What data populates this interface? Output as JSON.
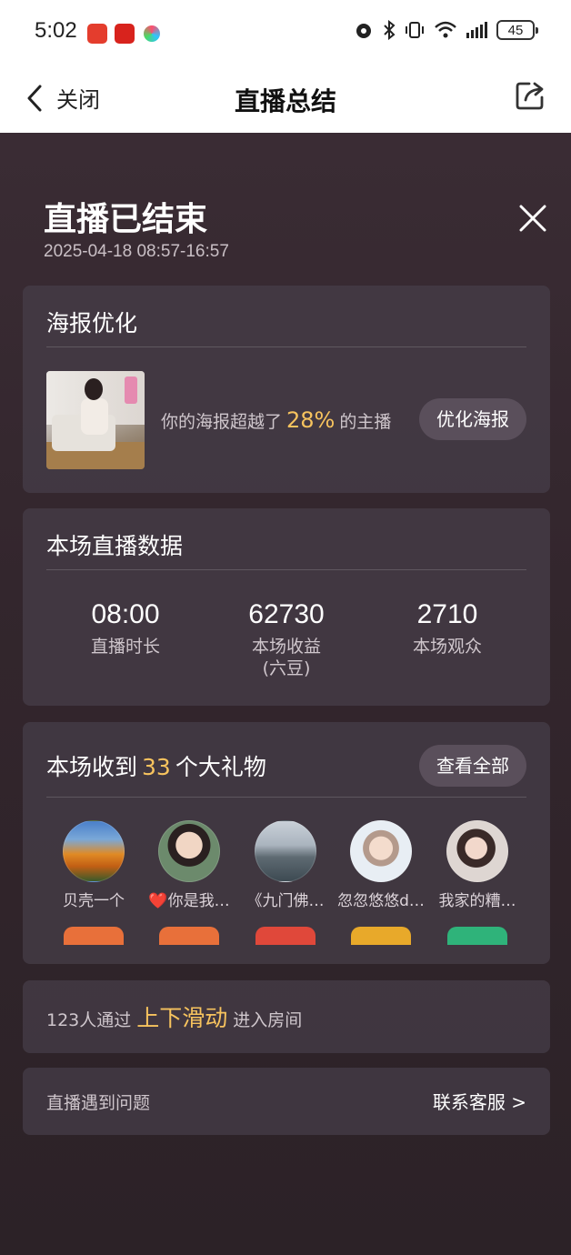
{
  "status_bar": {
    "time": "5:02",
    "signal_label": "6",
    "battery": "45",
    "icons": [
      "alarm-icon",
      "bluetooth-icon",
      "vibrate-icon",
      "wifi-icon",
      "signal-icon",
      "battery-icon"
    ]
  },
  "nav": {
    "back_label": "关闭",
    "title": "直播总结",
    "share_icon": "share-icon"
  },
  "summary": {
    "title": "直播已结束",
    "time_range": "2025-04-18 08:57-16:57"
  },
  "poster": {
    "heading": "海报优化",
    "text_before": "你的海报超越了",
    "percent": "28%",
    "text_after": "的主播",
    "button": "优化海报"
  },
  "stats": {
    "heading": "本场直播数据",
    "items": [
      {
        "value": "08:00",
        "label": "直播时长",
        "sub": ""
      },
      {
        "value": "62730",
        "label": "本场收益",
        "sub": "(六豆)"
      },
      {
        "value": "2710",
        "label": "本场观众",
        "sub": ""
      }
    ]
  },
  "gifts": {
    "heading_before": "本场收到",
    "count": "33",
    "heading_after": "个大礼物",
    "button": "查看全部",
    "givers": [
      {
        "name": "贝壳一个",
        "badge_color": "#e8703a"
      },
      {
        "name": "❤️你是我…",
        "badge_color": "#e8703a"
      },
      {
        "name": "《九门佛…",
        "badge_color": "#e0483a"
      },
      {
        "name": "忽忽悠悠d…",
        "badge_color": "#e8a92a"
      },
      {
        "name": "我家的糟…",
        "badge_color": "#2fb37a"
      }
    ]
  },
  "swipe": {
    "count_text": "123人通过",
    "highlight": "上下滑动",
    "after_text": "进入房间"
  },
  "help": {
    "label": "直播遇到问题",
    "link": "联系客服 >"
  },
  "colors": {
    "accent": "#f7c35e",
    "background_dark": "#33262d",
    "card": "#463e4a"
  }
}
